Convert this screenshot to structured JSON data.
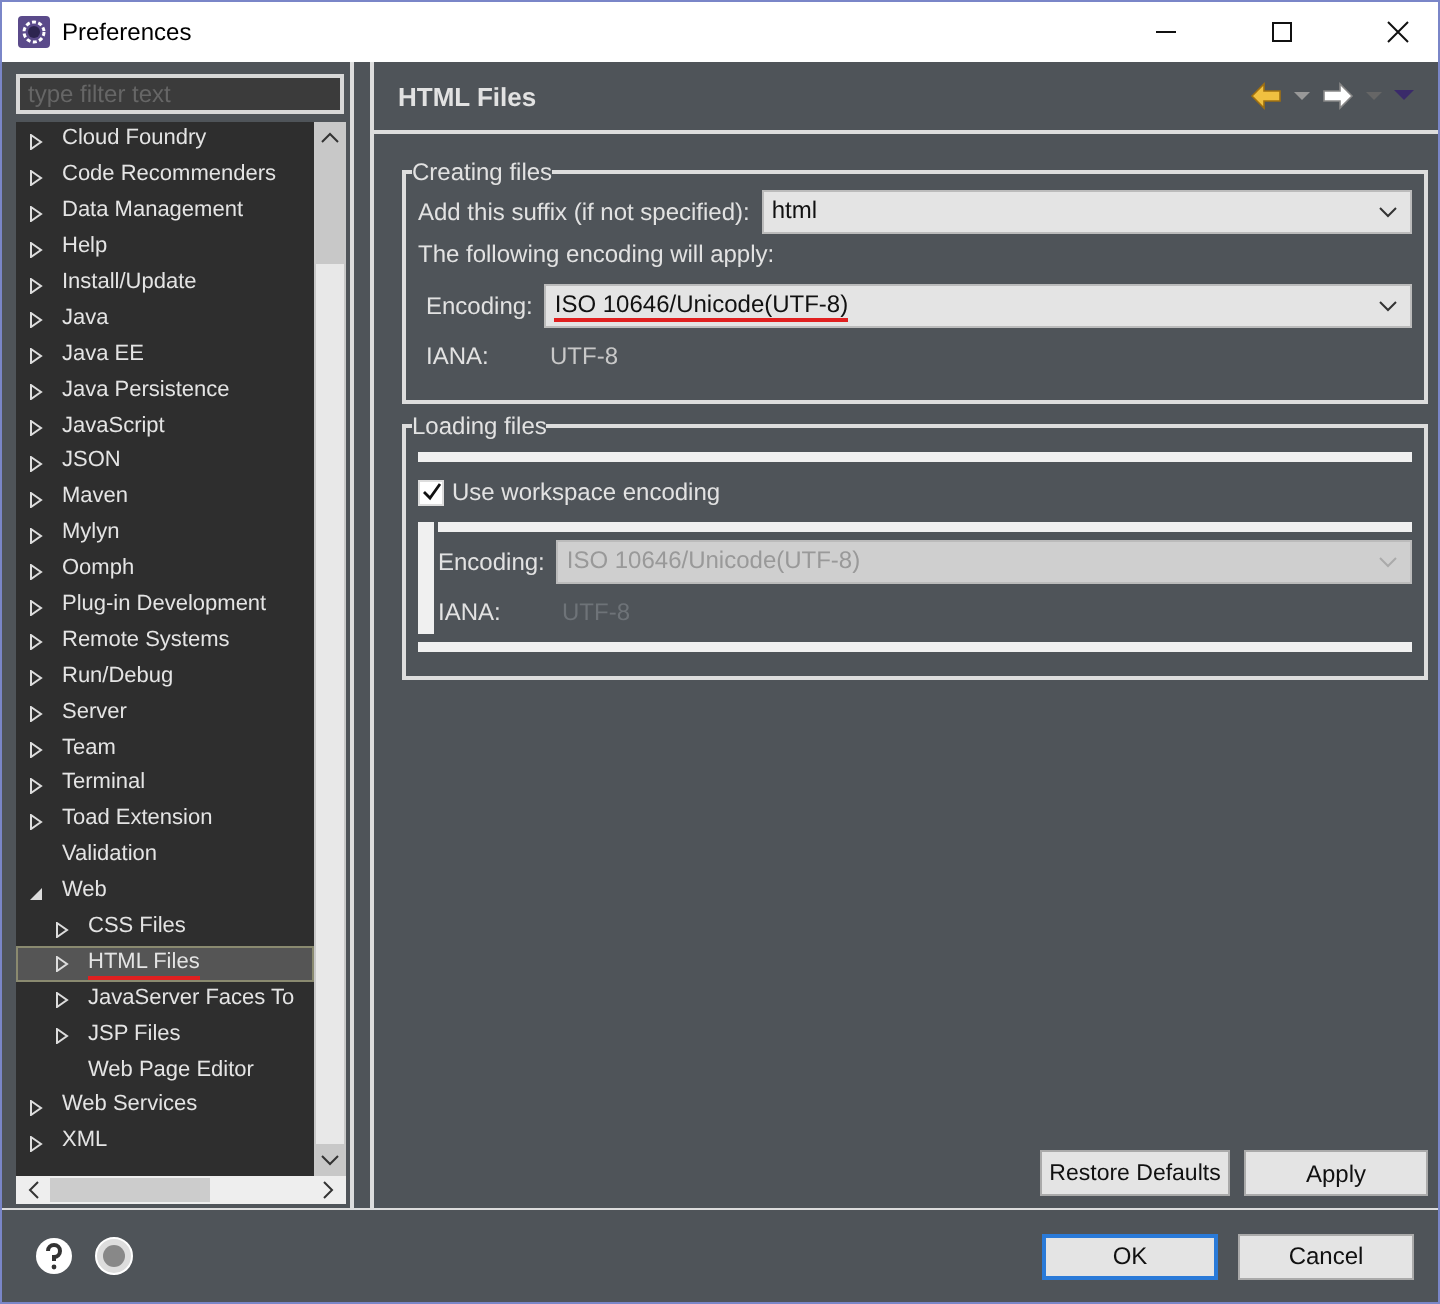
{
  "window": {
    "title": "Preferences"
  },
  "filter": {
    "placeholder": "type filter text"
  },
  "tree": [
    {
      "label": "Cloud Foundry",
      "kind": "group",
      "expanded": false,
      "selected": false
    },
    {
      "label": "Code Recommenders",
      "kind": "group",
      "expanded": false,
      "selected": false
    },
    {
      "label": "Data Management",
      "kind": "group",
      "expanded": false,
      "selected": false
    },
    {
      "label": "Help",
      "kind": "group",
      "expanded": false,
      "selected": false
    },
    {
      "label": "Install/Update",
      "kind": "group",
      "expanded": false,
      "selected": false
    },
    {
      "label": "Java",
      "kind": "group",
      "expanded": false,
      "selected": false
    },
    {
      "label": "Java EE",
      "kind": "group",
      "expanded": false,
      "selected": false
    },
    {
      "label": "Java Persistence",
      "kind": "group",
      "expanded": false,
      "selected": false
    },
    {
      "label": "JavaScript",
      "kind": "group",
      "expanded": false,
      "selected": false
    },
    {
      "label": "JSON",
      "kind": "group",
      "expanded": false,
      "selected": false
    },
    {
      "label": "Maven",
      "kind": "group",
      "expanded": false,
      "selected": false
    },
    {
      "label": "Mylyn",
      "kind": "group",
      "expanded": false,
      "selected": false
    },
    {
      "label": "Oomph",
      "kind": "group",
      "expanded": false,
      "selected": false
    },
    {
      "label": "Plug-in Development",
      "kind": "group",
      "expanded": false,
      "selected": false
    },
    {
      "label": "Remote Systems",
      "kind": "group",
      "expanded": false,
      "selected": false
    },
    {
      "label": "Run/Debug",
      "kind": "group",
      "expanded": false,
      "selected": false
    },
    {
      "label": "Server",
      "kind": "group",
      "expanded": false,
      "selected": false
    },
    {
      "label": "Team",
      "kind": "group",
      "expanded": false,
      "selected": false
    },
    {
      "label": "Terminal",
      "kind": "group",
      "expanded": false,
      "selected": false
    },
    {
      "label": "Toad Extension",
      "kind": "group",
      "expanded": false,
      "selected": false
    },
    {
      "label": "Validation",
      "kind": "leaf",
      "selected": false
    },
    {
      "label": "Web",
      "kind": "group",
      "expanded": true,
      "selected": false,
      "children": [
        {
          "label": "CSS Files",
          "kind": "group",
          "expanded": false,
          "selected": false
        },
        {
          "label": "HTML Files",
          "kind": "group",
          "expanded": false,
          "selected": true,
          "underlined": true
        },
        {
          "label": "JavaServer Faces To",
          "kind": "group",
          "expanded": false,
          "selected": false
        },
        {
          "label": "JSP Files",
          "kind": "group",
          "expanded": false,
          "selected": false
        },
        {
          "label": "Web Page Editor",
          "kind": "leaf",
          "selected": false
        }
      ]
    },
    {
      "label": "Web Services",
      "kind": "group",
      "expanded": false,
      "selected": false
    },
    {
      "label": "XML",
      "kind": "group",
      "expanded": false,
      "selected": false
    }
  ],
  "page": {
    "title": "HTML Files",
    "creating": {
      "title": "Creating files",
      "suffix_label": "Add this suffix (if not specified):",
      "suffix_value": "html",
      "note": "The following encoding will apply:",
      "encoding_label": "Encoding:",
      "encoding_value": "ISO 10646/Unicode(UTF-8)",
      "encoding_underlined": true,
      "iana_label": "IANA:",
      "iana_value": "UTF-8"
    },
    "loading": {
      "title": "Loading files",
      "checkbox_label": "Use workspace encoding",
      "checked": true,
      "encoding_label": "Encoding:",
      "encoding_value": "ISO 10646/Unicode(UTF-8)",
      "encoding_disabled": true,
      "iana_label": "IANA:",
      "iana_value": "UTF-8"
    },
    "buttons": [
      "Restore Defaults",
      "Apply"
    ]
  },
  "footer": {
    "buttons": [
      "OK",
      "Cancel"
    ]
  }
}
